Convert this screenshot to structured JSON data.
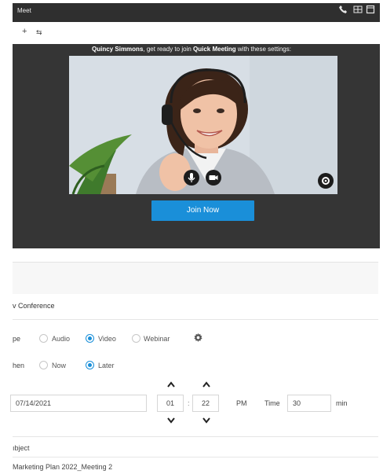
{
  "window": {
    "title": "Meet",
    "icons": [
      "phone-icon",
      "grid-icon",
      "window-icon"
    ]
  },
  "toolbar": {
    "icons": [
      "plus-icon",
      "share-icon"
    ]
  },
  "preview": {
    "user": "Quincy Simmons",
    "greeting_mid": ", get ready to join ",
    "meeting_name": "Quick Meeting",
    "greeting_end": " with these settings:",
    "controls": [
      "microphone-icon",
      "camera-icon",
      "settings-icon"
    ]
  },
  "join_label": "Join Now",
  "form": {
    "conference_title": "v Conference",
    "type_label": "pe",
    "type_options": [
      {
        "label": "Audio",
        "selected": false
      },
      {
        "label": "Video",
        "selected": true
      },
      {
        "label": "Webinar",
        "selected": false
      }
    ],
    "when_label": "hen",
    "when_options": [
      {
        "label": "Now",
        "selected": false
      },
      {
        "label": "Later",
        "selected": true
      }
    ],
    "date": "07/14/2021",
    "hour": "01",
    "separator": ":",
    "minute": "22",
    "ampm": "PM",
    "time_label": "Time",
    "duration": "30",
    "duration_unit": "min",
    "subject_label": "ıbject",
    "subject_value": "Marketing Plan 2022_Meeting 2"
  },
  "colors": {
    "accent": "#1a8fd9",
    "dark_panel": "#353535",
    "titlebar": "#2f2f2f"
  }
}
